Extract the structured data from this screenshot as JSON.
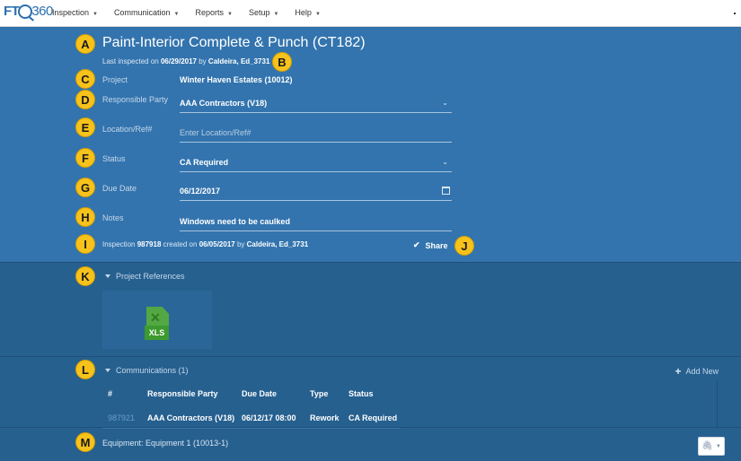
{
  "nav": {
    "logo": {
      "prefix": "FT",
      "suffix": "360"
    },
    "items": [
      {
        "label": "Inspection"
      },
      {
        "label": "Communication"
      },
      {
        "label": "Reports"
      },
      {
        "label": "Setup"
      },
      {
        "label": "Help"
      }
    ]
  },
  "badges": [
    "A",
    "B",
    "C",
    "D",
    "E",
    "F",
    "G",
    "H",
    "I",
    "J",
    "K",
    "L",
    "M"
  ],
  "inspection": {
    "title": "Paint-Interior Complete & Punch (CT182)",
    "last_inspected_prefix": "Last inspected on",
    "last_inspected_date": "06/29/2017",
    "by_word": "by",
    "last_inspected_by": "Caldeira, Ed_3731"
  },
  "fields": {
    "project": {
      "label": "Project",
      "value": "Winter Haven Estates (10012)"
    },
    "responsible_party": {
      "label": "Responsible Party",
      "value": "AAA Contractors (V18)"
    },
    "location": {
      "label": "Location/Ref#",
      "placeholder": "Enter Location/Ref#"
    },
    "status": {
      "label": "Status",
      "value": "CA Required"
    },
    "due_date": {
      "label": "Due Date",
      "value": "06/12/2017"
    },
    "notes": {
      "label": "Notes",
      "value": "Windows need to be caulked"
    }
  },
  "created": {
    "prefix": "Inspection",
    "number": "987918",
    "mid": "created on",
    "date": "06/05/2017",
    "by_word": "by",
    "by": "Caldeira, Ed_3731"
  },
  "share_label": "Share",
  "project_references": {
    "label": "Project References",
    "file_icon_label": "XLS"
  },
  "communications": {
    "label": "Communications (1)",
    "add_new_label": "Add New",
    "columns": [
      "#",
      "Responsible Party",
      "Due Date",
      "Type",
      "Status"
    ],
    "rows": [
      {
        "id": "987921",
        "party": "AAA Contractors (V18)",
        "due": "06/12/17 08:00",
        "type": "Rework",
        "status": "CA Required"
      }
    ]
  },
  "equipment": {
    "label": "Equipment: Equipment 1 (10013-1)"
  },
  "colors": {
    "header_bg": "#3374ae",
    "lower_bg": "#26608f",
    "badge": "#f7c21b",
    "link": "#6a9ccc"
  }
}
